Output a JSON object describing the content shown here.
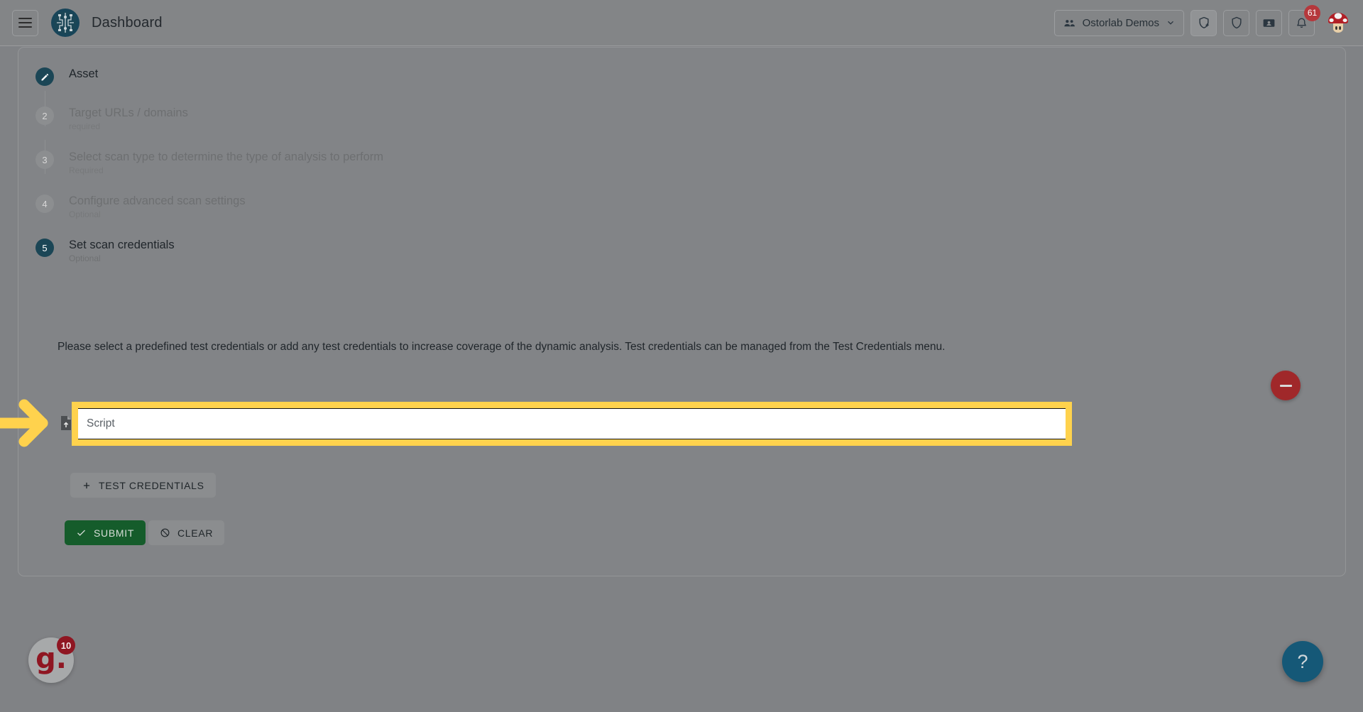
{
  "header": {
    "menu_icon": "hamburger-menu-icon",
    "logo_icon": "ostorlab-circuit-logo",
    "title": "Dashboard",
    "org_selector": {
      "icon": "people-group-icon",
      "label": "Ostorlab Demos",
      "chevron": "chevron-down-icon"
    },
    "actions": [
      {
        "name": "add-scan-icon",
        "icon": "shield-plus-icon",
        "active": true
      },
      {
        "name": "security-icon",
        "icon": "shield-icon",
        "active": false
      },
      {
        "name": "tickets-icon",
        "icon": "ticket-id-icon",
        "active": false
      },
      {
        "name": "notifications-icon",
        "icon": "bell-icon",
        "active": false,
        "badge": "61"
      }
    ],
    "avatar": "mushroom-avatar"
  },
  "stepper": {
    "steps": [
      {
        "index": "1",
        "marker": "pencil-icon",
        "state": "done",
        "title": "Asset",
        "subtitle": ""
      },
      {
        "index": "2",
        "marker": "2",
        "state": "idle",
        "title": "Target URLs / domains",
        "subtitle": "required"
      },
      {
        "index": "3",
        "marker": "3",
        "state": "idle",
        "title": "Select scan type to determine the type of analysis to perform",
        "subtitle": "Required"
      },
      {
        "index": "4",
        "marker": "4",
        "state": "idle",
        "title": "Configure advanced scan settings",
        "subtitle": "Optional"
      },
      {
        "index": "5",
        "marker": "5",
        "state": "active",
        "title": "Set scan credentials",
        "subtitle": "Optional"
      }
    ]
  },
  "main": {
    "description": "Please select a predefined test credentials or add any test credentials to increase coverage of the dynamic analysis. Test credentials can be managed from the Test Credentials menu.",
    "script_field": {
      "icon": "file-upload-icon",
      "placeholder": "Script",
      "value": "",
      "highlighted": true,
      "highlight_color": "#ffd24d"
    },
    "remove_button": {
      "icon": "minus-icon",
      "color": "#a0282a"
    },
    "add_credentials_button": {
      "icon": "plus-icon",
      "label": "TEST CREDENTIALS"
    },
    "submit_button": {
      "icon": "check-icon",
      "label": "SUBMIT",
      "color": "#155c2b"
    },
    "clear_button": {
      "icon": "block-icon",
      "label": "CLEAR"
    }
  },
  "annotations": {
    "arrow": {
      "name": "yellow-pointer-arrow",
      "color": "#ffd24d",
      "direction": "right"
    }
  },
  "footer": {
    "grammarly_widget": {
      "letter": "g.",
      "count": "10"
    },
    "help_button": {
      "label": "?",
      "color": "#155877"
    }
  }
}
